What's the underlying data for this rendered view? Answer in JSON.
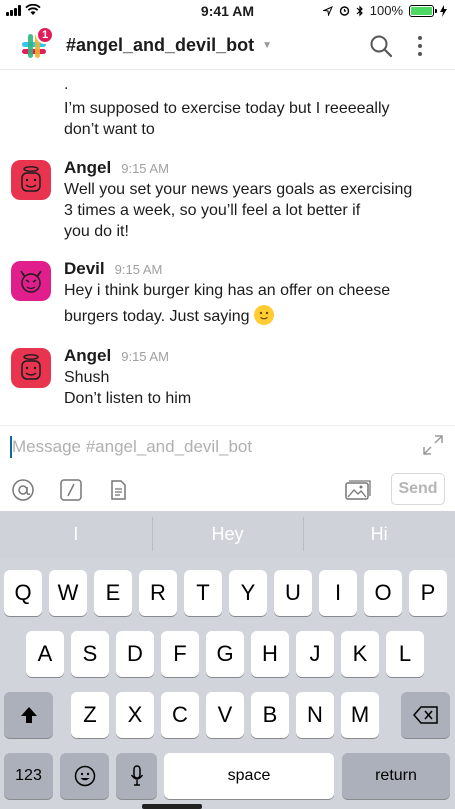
{
  "status_bar": {
    "time": "9:41 AM",
    "battery": "100%",
    "battery_level": 1.0
  },
  "header": {
    "badge_count": "1",
    "channel_name": "#angel_and_devil_bot"
  },
  "messages": {
    "continuation_dot": ".",
    "continuation_text_1": "I’m supposed to exercise today but I reeeeally",
    "continuation_text_2": "don’t want to",
    "items": [
      {
        "author": "Angel",
        "time": "9:15 AM",
        "lines": [
          "Well you set your news years goals as exercising",
          "3 times a week, so you’ll feel a lot better if",
          "you do it!"
        ]
      },
      {
        "author": "Devil",
        "time": "9:15 AM",
        "lines": [
          "Hey i think burger king has an offer on cheese",
          "burgers today. Just saying"
        ]
      },
      {
        "author": "Angel",
        "time": "9:15 AM",
        "lines": [
          "Shush",
          "Don’t listen to him"
        ]
      }
    ]
  },
  "composer": {
    "placeholder": "Message #angel_and_devil_bot",
    "send_label": "Send"
  },
  "keyboard": {
    "suggestions": [
      "I",
      "Hey",
      "Hi"
    ],
    "row1": [
      "Q",
      "W",
      "E",
      "R",
      "T",
      "Y",
      "U",
      "I",
      "O",
      "P"
    ],
    "row2": [
      "A",
      "S",
      "D",
      "F",
      "G",
      "H",
      "J",
      "K",
      "L"
    ],
    "row3": [
      "Z",
      "X",
      "C",
      "V",
      "B",
      "N",
      "M"
    ],
    "numbers_label": "123",
    "space_label": "space",
    "return_label": "return"
  },
  "colors": {
    "angel_avatar": "#e8344e",
    "devil_avatar": "#e01e8c",
    "badge": "#e01e5a",
    "battery": "#4cd964"
  }
}
